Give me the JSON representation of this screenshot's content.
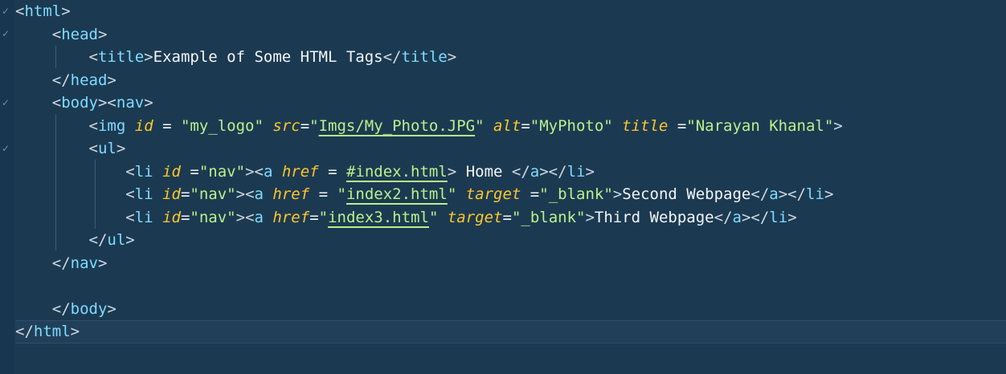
{
  "editor": {
    "colors": {
      "background": "#1b3a52",
      "tag": "#7fdbff",
      "attribute": "#ffc62a",
      "string": "#b9f18b",
      "text": "#f5f5f5"
    },
    "fold_icon": "check-fold-icon",
    "fold_glyph": "✓",
    "lines": {
      "l1": {
        "t1": "html"
      },
      "l2": {
        "t1": "head"
      },
      "l3": {
        "t1": "title",
        "text": "Example of Some HTML Tags",
        "t2": "title"
      },
      "l4": {
        "t1": "head"
      },
      "l5": {
        "t1": "body",
        "t2": "nav"
      },
      "l6": {
        "tag": "img",
        "a1": "id",
        "v1": "\"my_logo\"",
        "a2": "src",
        "v2_q1": "\"",
        "v2": "Imgs/My_Photo.JPG",
        "v2_q2": "\"",
        "a3": "alt",
        "v3": "\"MyPhoto\"",
        "a4": "title",
        "v4": "\"Narayan Khanal\""
      },
      "l7": {
        "t1": "ul"
      },
      "l8": {
        "t1": "li",
        "a1": "id",
        "v1": "\"nav\"",
        "t2": "a",
        "a2": "href",
        "v2": "#index.html",
        "text": " Home ",
        "t3": "a",
        "t4": "li"
      },
      "l9": {
        "t1": "li",
        "a1": "id",
        "v1": "\"nav\"",
        "t2": "a",
        "a2": "href",
        "v2_q1": "\"",
        "v2": "index2.html",
        "v2_q2": "\"",
        "a3": "target",
        "v3": "\"_blank\"",
        "text": "Second Webpage",
        "t3": "a",
        "t4": "li"
      },
      "l10": {
        "t1": "li",
        "a1": "id",
        "v1": "\"nav\"",
        "t2": "a",
        "a2": "href",
        "v2_q1": "\"",
        "v2": "index3.html",
        "v2_q2": "\"",
        "a3": "target",
        "v3": "\"_blank\"",
        "text": "Third Webpage",
        "t3": "a",
        "t4": "li"
      },
      "l11": {
        "t1": "ul"
      },
      "l12": {
        "t1": "nav"
      },
      "l14": {
        "t1": "body"
      },
      "l15": {
        "t1": "html"
      }
    }
  }
}
